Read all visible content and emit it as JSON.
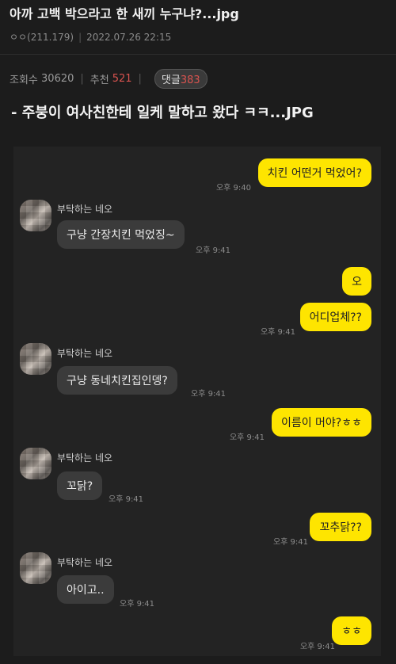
{
  "post": {
    "title": "아까 고백 박으라고 한 새끼 누구냐?...jpg",
    "author": "ㅇㅇ(211.179)",
    "date": "2022.07.26 22:15"
  },
  "stats": {
    "views_label": "조회수",
    "views": "30620",
    "recommend_label": "추천",
    "recommend": "521",
    "comments_label": "댓글",
    "comments": "383"
  },
  "headline": "- 주붕이 여사친한테 일케 말하고 왔다 ㅋㅋ...JPG",
  "chat": {
    "contact_name": "부탁하는 네오",
    "messages": [
      {
        "from": "me",
        "text": "치킨 어떤거 먹었어?",
        "time": "오후 9:40"
      },
      {
        "from": "them",
        "text": "구냥 간장치킨 먹었징~",
        "time": "오후 9:41"
      },
      {
        "from": "me",
        "text": "오",
        "time": ""
      },
      {
        "from": "me",
        "text": "어디업체??",
        "time": "오후 9:41"
      },
      {
        "from": "them",
        "text": "구냥 동네치킨집인뎅?",
        "time": "오후 9:41"
      },
      {
        "from": "me",
        "text": "이름이 머야?ㅎㅎ",
        "time": "오후 9:41"
      },
      {
        "from": "them",
        "text": "꼬닭?",
        "time": "오후 9:41"
      },
      {
        "from": "me",
        "text": "꼬추닭??",
        "time": "오후 9:41"
      },
      {
        "from": "them",
        "text": "아이고..",
        "time": "오후 9:41"
      },
      {
        "from": "me",
        "text": "ㅎㅎ",
        "time": "오후 9:41"
      }
    ]
  }
}
